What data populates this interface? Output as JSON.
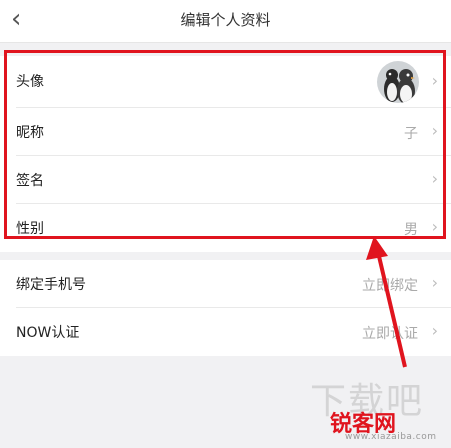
{
  "header": {
    "back_icon": "chevron-left-icon",
    "title": "编辑个人资料"
  },
  "profile": {
    "avatar_label": "头像",
    "nickname_label": "昵称",
    "nickname_value": "子",
    "signature_label": "签名",
    "gender_label": "性别",
    "gender_value": "男"
  },
  "account": {
    "phone_label": "绑定手机号",
    "phone_value": "立即绑定",
    "now_label": "NOW认证",
    "now_value": "立即认证"
  },
  "watermark": {
    "big_text": "下载吧",
    "brand": "锐客网",
    "url": "www.xiazaiba.com"
  },
  "colors": {
    "highlight": "#e0141e",
    "background": "#f1f1f3",
    "value_text": "#aaaaaa"
  }
}
